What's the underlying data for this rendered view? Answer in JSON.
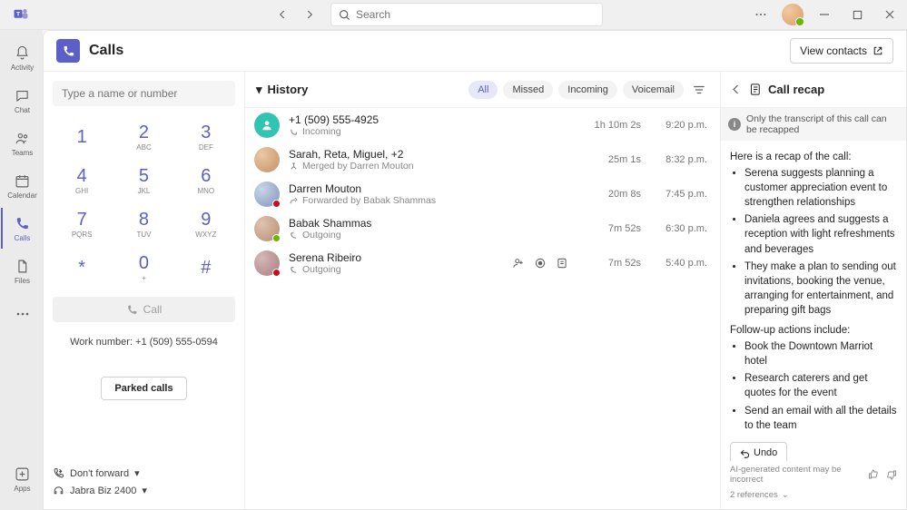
{
  "titlebar": {
    "search_placeholder": "Search"
  },
  "rail": {
    "activity": "Activity",
    "chat": "Chat",
    "teams": "Teams",
    "calendar": "Calendar",
    "calls": "Calls",
    "files": "Files",
    "apps": "Apps"
  },
  "header": {
    "title": "Calls",
    "view_contacts": "View contacts"
  },
  "dialer": {
    "input_placeholder": "Type a name or number",
    "keys": [
      {
        "n": "1",
        "l": ""
      },
      {
        "n": "2",
        "l": "ABC"
      },
      {
        "n": "3",
        "l": "DEF"
      },
      {
        "n": "4",
        "l": "GHI"
      },
      {
        "n": "5",
        "l": "JKL"
      },
      {
        "n": "6",
        "l": "MNO"
      },
      {
        "n": "7",
        "l": "PQRS"
      },
      {
        "n": "8",
        "l": "TUV"
      },
      {
        "n": "9",
        "l": "WXYZ"
      },
      {
        "n": "*",
        "l": ""
      },
      {
        "n": "0",
        "l": "+"
      },
      {
        "n": "#",
        "l": ""
      }
    ],
    "call_label": "Call",
    "work_number": "Work number: +1 (509) 555-0594",
    "parked": "Parked calls",
    "dont_forward": "Don't forward",
    "device": "Jabra Biz 2400"
  },
  "history": {
    "title": "History",
    "filters": {
      "all": "All",
      "missed": "Missed",
      "incoming": "Incoming",
      "voicemail": "Voicemail"
    },
    "rows": [
      {
        "name": "+1 (509) 555-4925",
        "sub": "Incoming",
        "dur": "1h 10m 2s",
        "time": "9:20 p.m.",
        "avatar": "unknown",
        "subicon": "incoming"
      },
      {
        "name": "Sarah, Reta, Miguel, +2",
        "sub": "Merged by Darren Mouton",
        "dur": "25m 1s",
        "time": "8:32 p.m.",
        "avatar": "img1",
        "subicon": "merge"
      },
      {
        "name": "Darren Mouton",
        "sub": "Forwarded by Babak Shammas",
        "dur": "20m 8s",
        "time": "7:45 p.m.",
        "avatar": "img2",
        "presence": "busy",
        "subicon": "forward"
      },
      {
        "name": "Babak Shammas",
        "sub": "Outgoing",
        "dur": "7m 52s",
        "time": "6:30 p.m.",
        "avatar": "img3",
        "presence": "avail",
        "subicon": "outgoing"
      },
      {
        "name": "Serena Ribeiro",
        "sub": "Outgoing",
        "dur": "7m 52s",
        "time": "5:40 p.m.",
        "avatar": "img4",
        "presence": "dnd",
        "subicon": "outgoing",
        "actions": true
      }
    ]
  },
  "recap": {
    "title": "Call recap",
    "banner": "Only the transcript of this call can be recapped",
    "intro": "Here is a recap of the call:",
    "bullets_a": [
      "Serena suggests planning a customer appreciation event to strengthen relationships",
      "Daniela agrees and suggests a reception with light refreshments and beverages",
      "They make a plan to sending out invitations, booking the venue, arranging for entertainment, and preparing gift bags"
    ],
    "followup_intro": "Follow-up actions include:",
    "bullets_b": [
      "Book the Downtown Marriot hotel",
      "Research caterers and get quotes for the event",
      "Send an email with all the details to the team"
    ],
    "undo": "Undo",
    "ai_note": "AI-generated content may be incorrect",
    "refs": "2 references"
  }
}
